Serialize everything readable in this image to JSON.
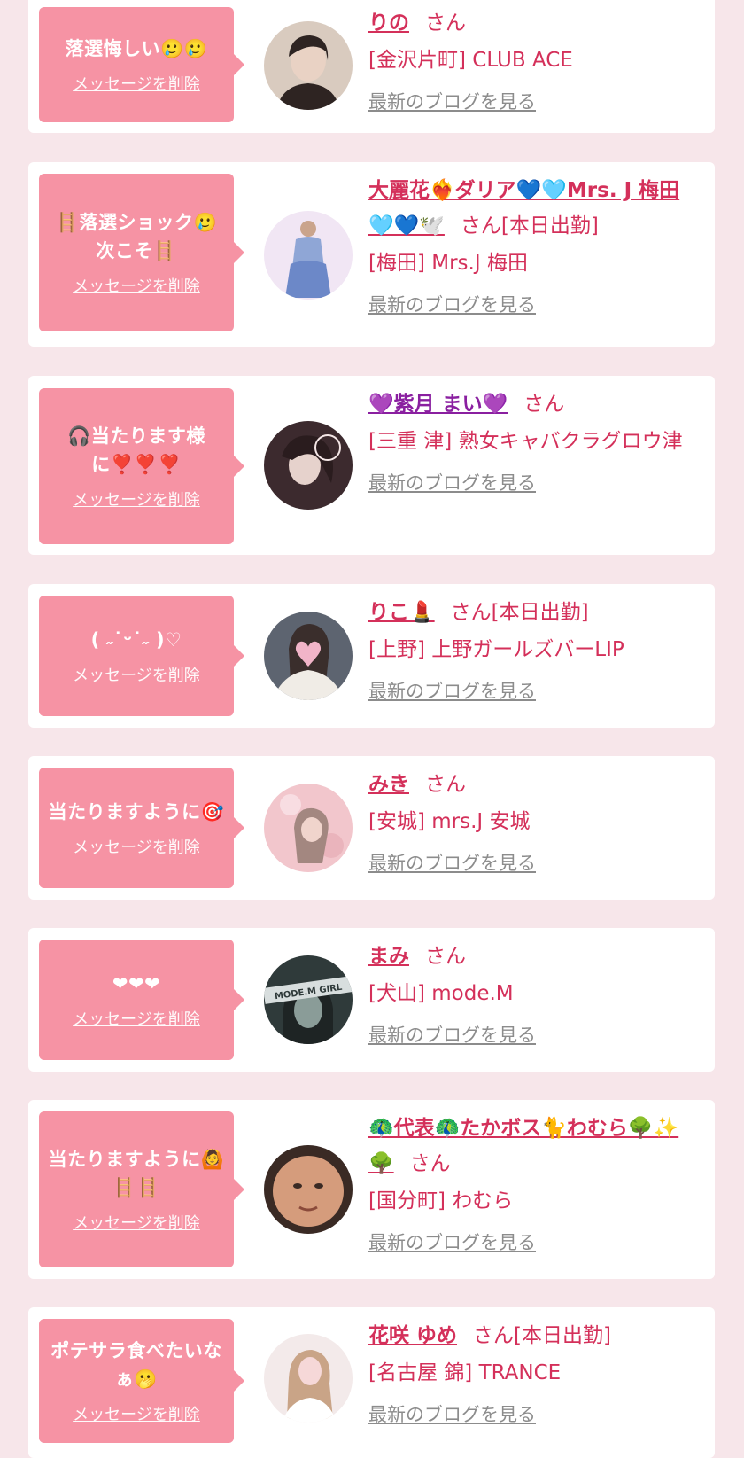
{
  "entries": [
    {
      "message": "落選悔しい🥲🥲",
      "delete_label": "メッセージを削除",
      "name": "りの",
      "honorific": "さん",
      "status": "",
      "shop": "[金沢片町] CLUB ACE",
      "blog_label": "最新のブログを見る",
      "avatar_colors": [
        "#d9cbbf",
        "#2e2422"
      ]
    },
    {
      "message": "🪜落選ショック🥲次こそ🪜",
      "delete_label": "メッセージを削除",
      "name": "大麗花❤️‍🔥ダリア💙🩵Mrs. J 梅田🩵💙🕊️",
      "honorific": "さん",
      "status": "[本日出勤]",
      "shop": "[梅田] Mrs.J 梅田",
      "blog_label": "最新のブログを見る",
      "avatar_colors": [
        "#e6d6ee",
        "#8fa6d6"
      ]
    },
    {
      "message": "🎧当たります様に❣️❣️❣️",
      "delete_label": "メッセージを削除",
      "name": "💜紫月 まい💜",
      "honorific": "さん",
      "status": "",
      "shop": "[三重 津] 熟女キャバクラグロウ津",
      "blog_label": "最新のブログを見る",
      "avatar_colors": [
        "#3c2a2e",
        "#d9c6c6"
      ]
    },
    {
      "message": "( ˶˙ᵕ˙˶ )♡",
      "delete_label": "メッセージを削除",
      "name": "りこ💄",
      "honorific": "さん",
      "status": "[本日出勤]",
      "shop": "[上野] 上野ガールズバーLIP",
      "blog_label": "最新のブログを見る",
      "avatar_colors": [
        "#5d6470",
        "#f1b4c8"
      ]
    },
    {
      "message": "当たりますように🎯",
      "delete_label": "メッセージを削除",
      "name": "みき",
      "honorific": "さん",
      "status": "",
      "shop": "[安城] mrs.J 安城",
      "blog_label": "最新のブログを見る",
      "avatar_colors": [
        "#f2c6cc",
        "#a38780"
      ]
    },
    {
      "message": "❤❤❤",
      "delete_label": "メッセージを削除",
      "name": "まみ",
      "honorific": "さん",
      "status": "",
      "shop": "[犬山] mode.M",
      "blog_label": "最新のブログを見る",
      "avatar_colors": [
        "#2f3a3a",
        "#8a9c98"
      ],
      "avatar_text": "MODE.M GIRL"
    },
    {
      "message": "当たりますように🙆🪜🪜",
      "delete_label": "メッセージを削除",
      "name": "🦚代表🦚たかボス🐈わむら🌳✨🌳",
      "honorific": "さん",
      "status": "",
      "shop": "[国分町] わむら",
      "blog_label": "最新のブログを見る",
      "avatar_colors": [
        "#3a2a24",
        "#d59c7c"
      ]
    },
    {
      "message": "ポテサラ食べたいなぁ🫢",
      "delete_label": "メッセージを削除",
      "name": "花咲 ゆめ",
      "honorific": "さん",
      "status": "[本日出勤]",
      "shop": "[名古屋 錦] TRANCE",
      "blog_label": "最新のブログを見る",
      "avatar_colors": [
        "#f3eaea",
        "#c9a487"
      ]
    }
  ]
}
